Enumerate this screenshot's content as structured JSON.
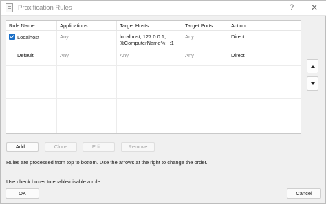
{
  "window": {
    "title": "Proxification Rules",
    "help_label": "?",
    "close_label": "✕"
  },
  "table": {
    "columns": [
      "Rule Name",
      "Applications",
      "Target Hosts",
      "Target Ports",
      "Action"
    ],
    "rows": [
      {
        "checked": true,
        "name": "Localhost",
        "applications": "Any",
        "target_hosts_line1": "localhost; 127.0.0.1;",
        "target_hosts_line2": "%ComputerName%; ::1",
        "target_ports": "Any",
        "action": "Direct"
      },
      {
        "checked": false,
        "name": "Default",
        "applications": "Any",
        "target_hosts_line1": "Any",
        "target_hosts_line2": "",
        "target_ports": "Any",
        "action": "Direct"
      }
    ]
  },
  "side_buttons": {
    "up_icon": "triangle-up-icon",
    "down_icon": "triangle-down-icon"
  },
  "buttons": {
    "add": "Add...",
    "clone": "Clone",
    "edit": "Edit...",
    "remove": "Remove",
    "ok": "OK",
    "cancel": "Cancel"
  },
  "description": {
    "line1": "Rules are processed from top to bottom. Use the arrows at the right to change the order.",
    "line2": "Use check boxes to enable/disable a rule."
  },
  "colors": {
    "checkbox_accent": "#1a6fc7"
  }
}
